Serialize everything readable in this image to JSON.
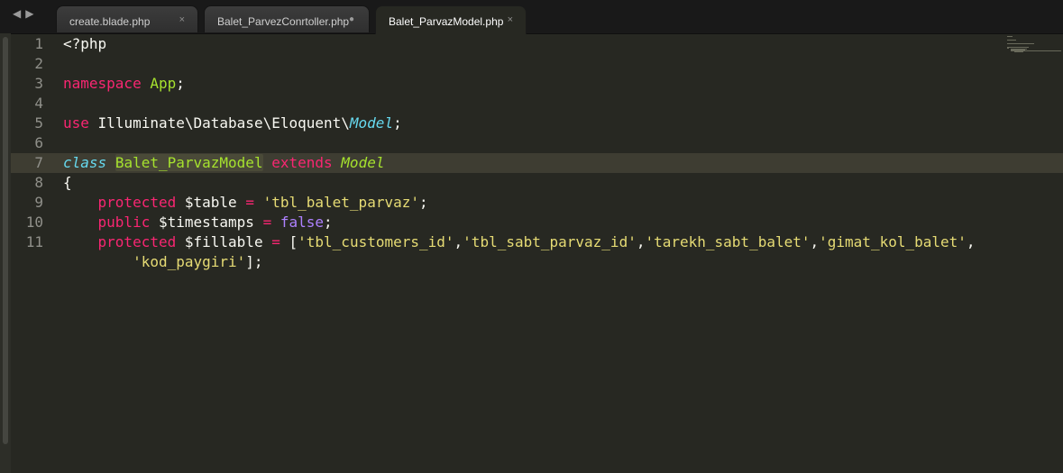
{
  "nav": {
    "back_icon": "◀",
    "forward_icon": "▶"
  },
  "tabs": [
    {
      "label": "create.blade.php",
      "close": "×",
      "active": false
    },
    {
      "label": "Balet_ParvezConrtoller.php",
      "dirty": "●",
      "active": false
    },
    {
      "label": "Balet_ParvazModel.php",
      "close": "×",
      "active": true
    }
  ],
  "editor": {
    "line_numbers": [
      "1",
      "2",
      "3",
      "4",
      "5",
      "6",
      "7",
      "8",
      "9",
      "10",
      "11"
    ],
    "code": {
      "l1": "<?php",
      "l3_kw": "namespace",
      "l3_ns": "App",
      "l3_end": ";",
      "l5_kw": "use",
      "l5_path": "Illuminate\\Database\\Eloquent\\",
      "l5_cls": "Model",
      "l5_end": ";",
      "l7_kw": "class",
      "l7_name": "Balet_ParvazModel",
      "l7_ext": "extends",
      "l7_parent": "Model",
      "l8": "{",
      "l9_kw": "protected",
      "l9_var": "$table",
      "l9_op": "=",
      "l9_str": "'tbl_balet_parvaz'",
      "l9_end": ";",
      "l10_kw": "public",
      "l10_var": "$timestamps",
      "l10_op": "=",
      "l10_val": "false",
      "l10_end": ";",
      "l11_kw": "protected",
      "l11_var": "$fillable",
      "l11_op": "=",
      "l11_open": "[",
      "l11_s1": "'tbl_customers_id'",
      "l11_s2": "'tbl_sabt_parvaz_id'",
      "l11_s3": "'tarekh_sabt_balet'",
      "l11_s4": "'gimat_kol_balet'",
      "comma": ",",
      "l11b_s5": "'kod_paygiri'",
      "l11b_end": "];"
    }
  },
  "colors": {
    "background": "#272822",
    "keyword": "#f92672",
    "type": "#66d9ef",
    "class": "#a6e22e",
    "string": "#e6db74",
    "constant": "#ae81ff"
  }
}
